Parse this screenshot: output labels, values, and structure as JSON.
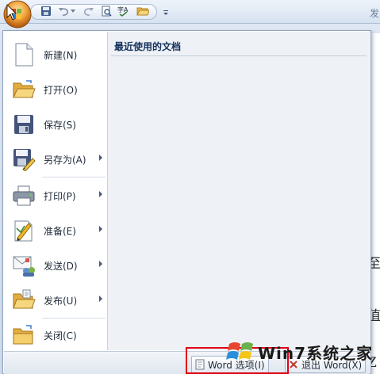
{
  "quick_access": {
    "icons": [
      "office-orb-icon",
      "save-icon",
      "undo-icon",
      "redo-icon",
      "print-preview-icon",
      "spelling-icon",
      "open-icon",
      "customize-icon"
    ]
  },
  "background": {
    "right_tab_fragment": "发",
    "right_glyphs": [
      "至",
      "值",
      "Z"
    ]
  },
  "menu": {
    "items": [
      {
        "label": "新建(N)",
        "icon": "new-document-icon",
        "submenu": false
      },
      {
        "label": "打开(O)",
        "icon": "open-folder-icon",
        "submenu": false
      },
      {
        "label": "保存(S)",
        "icon": "save-icon",
        "submenu": false
      },
      {
        "label": "另存为(A)",
        "icon": "save-as-icon",
        "submenu": true
      },
      {
        "label": "打印(P)",
        "icon": "printer-icon",
        "submenu": true
      },
      {
        "label": "准备(E)",
        "icon": "prepare-icon",
        "submenu": true
      },
      {
        "label": "发送(D)",
        "icon": "send-icon",
        "submenu": true
      },
      {
        "label": "发布(U)",
        "icon": "publish-icon",
        "submenu": true
      },
      {
        "label": "关闭(C)",
        "icon": "close-folder-icon",
        "submenu": false
      }
    ],
    "recent_title": "最近使用的文档",
    "options_button": "Word 选项(I)",
    "exit_button": "退出 Word(X)"
  },
  "watermark": {
    "text": "Win7系统之家"
  },
  "colors": {
    "highlight": "#e00016",
    "accent": "#15325d"
  }
}
